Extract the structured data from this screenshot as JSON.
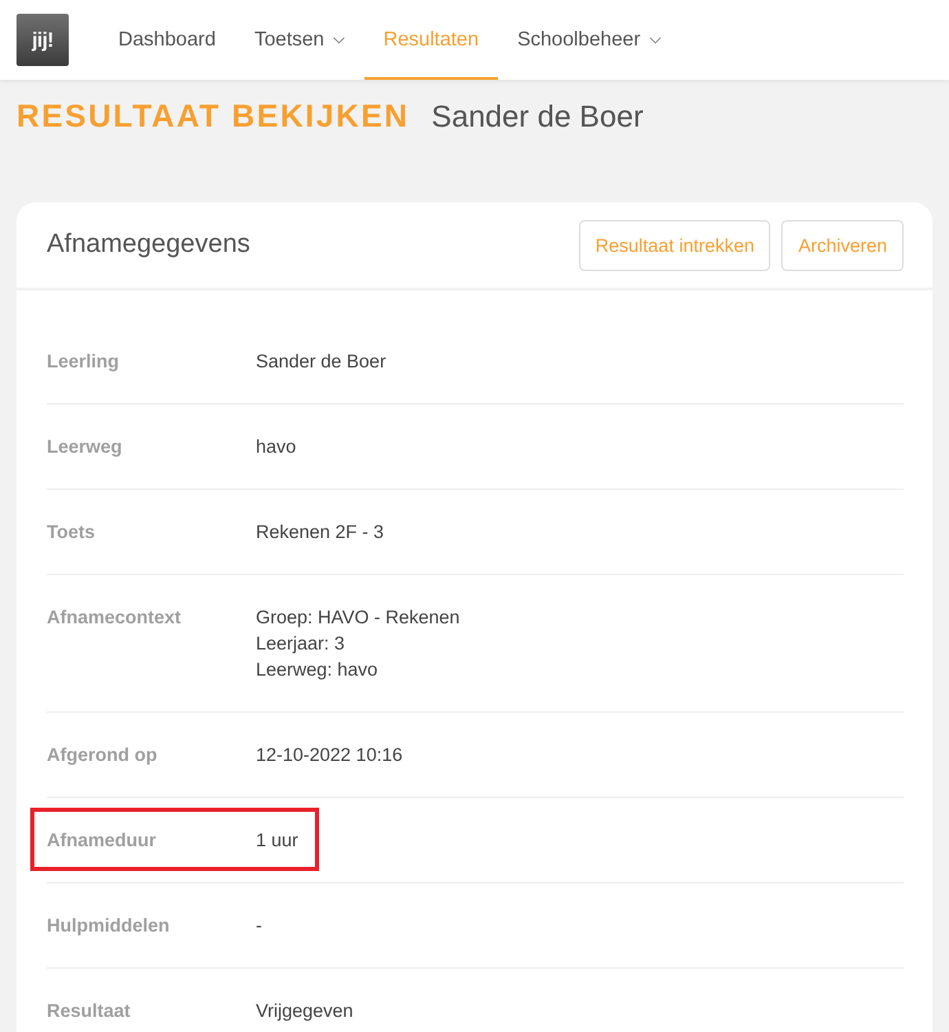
{
  "logo": {
    "text": "jij!"
  },
  "nav": [
    {
      "label": "Dashboard",
      "selected": false,
      "dropdown": false
    },
    {
      "label": "Toetsen",
      "selected": false,
      "dropdown": true
    },
    {
      "label": "Resultaten",
      "selected": true,
      "dropdown": false
    },
    {
      "label": "Schoolbeheer",
      "selected": false,
      "dropdown": true
    }
  ],
  "page_header": {
    "title": "RESULTAAT BEKIJKEN",
    "subtitle": "Sander de Boer"
  },
  "card": {
    "title": "Afnamegegevens",
    "buttons": [
      "Resultaat intrekken",
      "Archiveren"
    ],
    "rows": [
      {
        "label": "Leerling",
        "value": [
          "Sander de Boer"
        ],
        "highlighted": false
      },
      {
        "label": "Leerweg",
        "value": [
          "havo"
        ],
        "highlighted": false
      },
      {
        "label": "Toets",
        "value": [
          "Rekenen 2F - 3"
        ],
        "highlighted": false
      },
      {
        "label": "Afnamecontext",
        "value": [
          "Groep: HAVO - Rekenen",
          "Leerjaar: 3",
          "Leerweg: havo"
        ],
        "highlighted": false
      },
      {
        "label": "Afgerond op",
        "value": [
          "12-10-2022 10:16"
        ],
        "highlighted": false
      },
      {
        "label": "Afnameduur",
        "value": [
          "1 uur"
        ],
        "highlighted": true
      },
      {
        "label": "Hulpmiddelen",
        "value": [
          "-"
        ],
        "highlighted": false
      },
      {
        "label": "Resultaat",
        "value": [
          "Vrijgegeven"
        ],
        "highlighted": false
      }
    ]
  }
}
